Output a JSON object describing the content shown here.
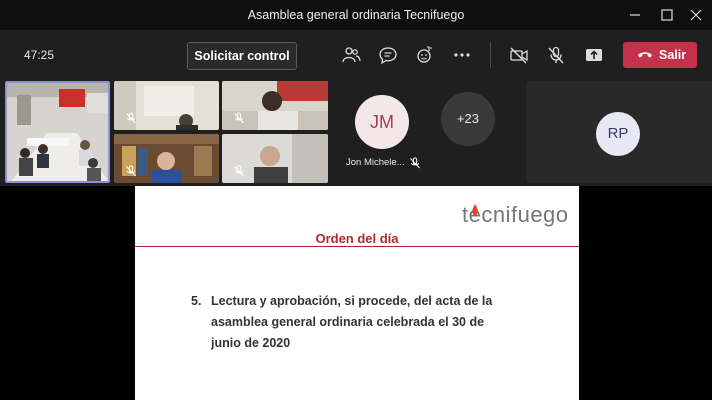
{
  "window": {
    "title": "Asamblea general ordinaria Tecnifuego"
  },
  "toolbar": {
    "timer": "47:25",
    "request_control_label": "Solicitar control",
    "leave_label": "Salir"
  },
  "participants": {
    "jm": {
      "initials": "JM",
      "name": "Jon Michele..."
    },
    "more": {
      "count": "+23"
    },
    "rp": {
      "initials": "RP"
    }
  },
  "slide": {
    "logo": "tecnifuego",
    "heading": "Orden del día",
    "item_number": "5.",
    "item_text": "Lectura y aprobación, si procede, del acta de la asamblea general ordinaria celebrada el 30 de junio de 2020"
  },
  "colors": {
    "leave": "#c4314b",
    "accent": "#b02a2a",
    "avatar_bg": "#e8e8f5"
  }
}
